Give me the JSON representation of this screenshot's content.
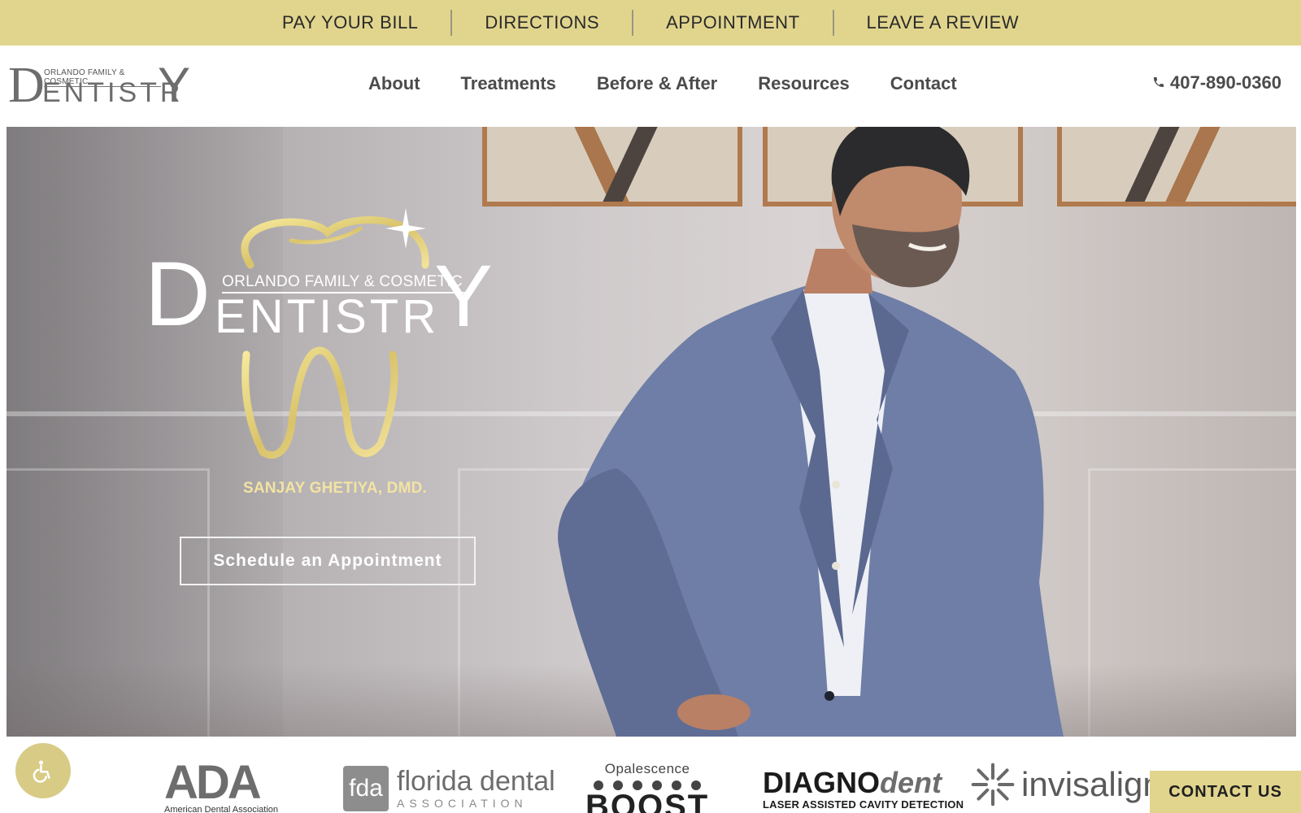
{
  "topbar": {
    "links": [
      "PAY YOUR BILL",
      "DIRECTIONS",
      "APPOINTMENT",
      "LEAVE A REVIEW"
    ]
  },
  "header": {
    "logo": {
      "small": "ORLANDO FAMILY & COSMETIC",
      "big_d": "D",
      "rest": "ENTISTR",
      "big_y": "Y"
    },
    "nav": [
      "About",
      "Treatments",
      "Before & After",
      "Resources",
      "Contact"
    ],
    "phone": "407-890-0360"
  },
  "hero": {
    "logo": {
      "small": "ORLANDO FAMILY & COSMETIC",
      "big_d": "D",
      "rest": "ENTISTR",
      "big_y": "Y"
    },
    "doctor_name": "SANJAY GHETIYA, DMD.",
    "cta_label": "Schedule an Appointment"
  },
  "badges": {
    "ada": {
      "mark": "ADA",
      "sub": "American Dental Association"
    },
    "fda": {
      "box": "fda",
      "t1": "florida dental",
      "t2": "ASSOCIATION"
    },
    "boost": {
      "t1": "Opalescence",
      "t2": "BOOST"
    },
    "diagno": {
      "main": "DIAGNO",
      "accent": "dent",
      "sub": "LASER ASSISTED CAVITY DETECTION"
    },
    "invis": {
      "word": "invisalign"
    }
  },
  "contact_button": "CONTACT US",
  "colors": {
    "accent_gold": "#e1d58e",
    "gold_text": "#f3e3a2",
    "nav_text": "#4b4b4b"
  },
  "icons": [
    "phone-icon",
    "accessibility-icon",
    "tooth-outline-icon",
    "sparkle-icon",
    "invisalign-star-icon"
  ]
}
